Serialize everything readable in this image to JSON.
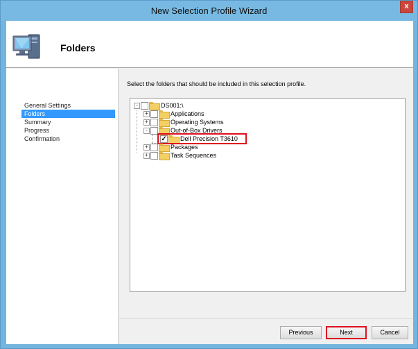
{
  "window": {
    "title": "New Selection Profile Wizard",
    "close_label": "x"
  },
  "header": {
    "title": "Folders",
    "icon": "computer-icon"
  },
  "nav": {
    "items": [
      {
        "label": "General Settings",
        "active": false
      },
      {
        "label": "Folders",
        "active": true
      },
      {
        "label": "Summary",
        "active": false
      },
      {
        "label": "Progress",
        "active": false
      },
      {
        "label": "Confirmation",
        "active": false
      }
    ]
  },
  "content": {
    "instruction": "Select the folders that should be included in this selection profile."
  },
  "tree": {
    "root": {
      "label": "DS001:\\",
      "expanded": true,
      "checked": false
    },
    "items": [
      {
        "label": "Applications",
        "expanded": false,
        "checked": false
      },
      {
        "label": "Operating Systems",
        "expanded": false,
        "checked": false
      },
      {
        "label": "Out-of-Box Drivers",
        "expanded": true,
        "checked": false
      },
      {
        "label": "Dell Precision T3610",
        "expanded": null,
        "checked": true
      },
      {
        "label": "Packages",
        "expanded": false,
        "checked": false
      },
      {
        "label": "Task Sequences",
        "expanded": false,
        "checked": false
      }
    ]
  },
  "buttons": {
    "previous": "Previous",
    "next": "Next",
    "cancel": "Cancel"
  },
  "colors": {
    "title_bar": "#77b9e2",
    "selection": "#3399ff",
    "highlight": "#e0101e"
  }
}
